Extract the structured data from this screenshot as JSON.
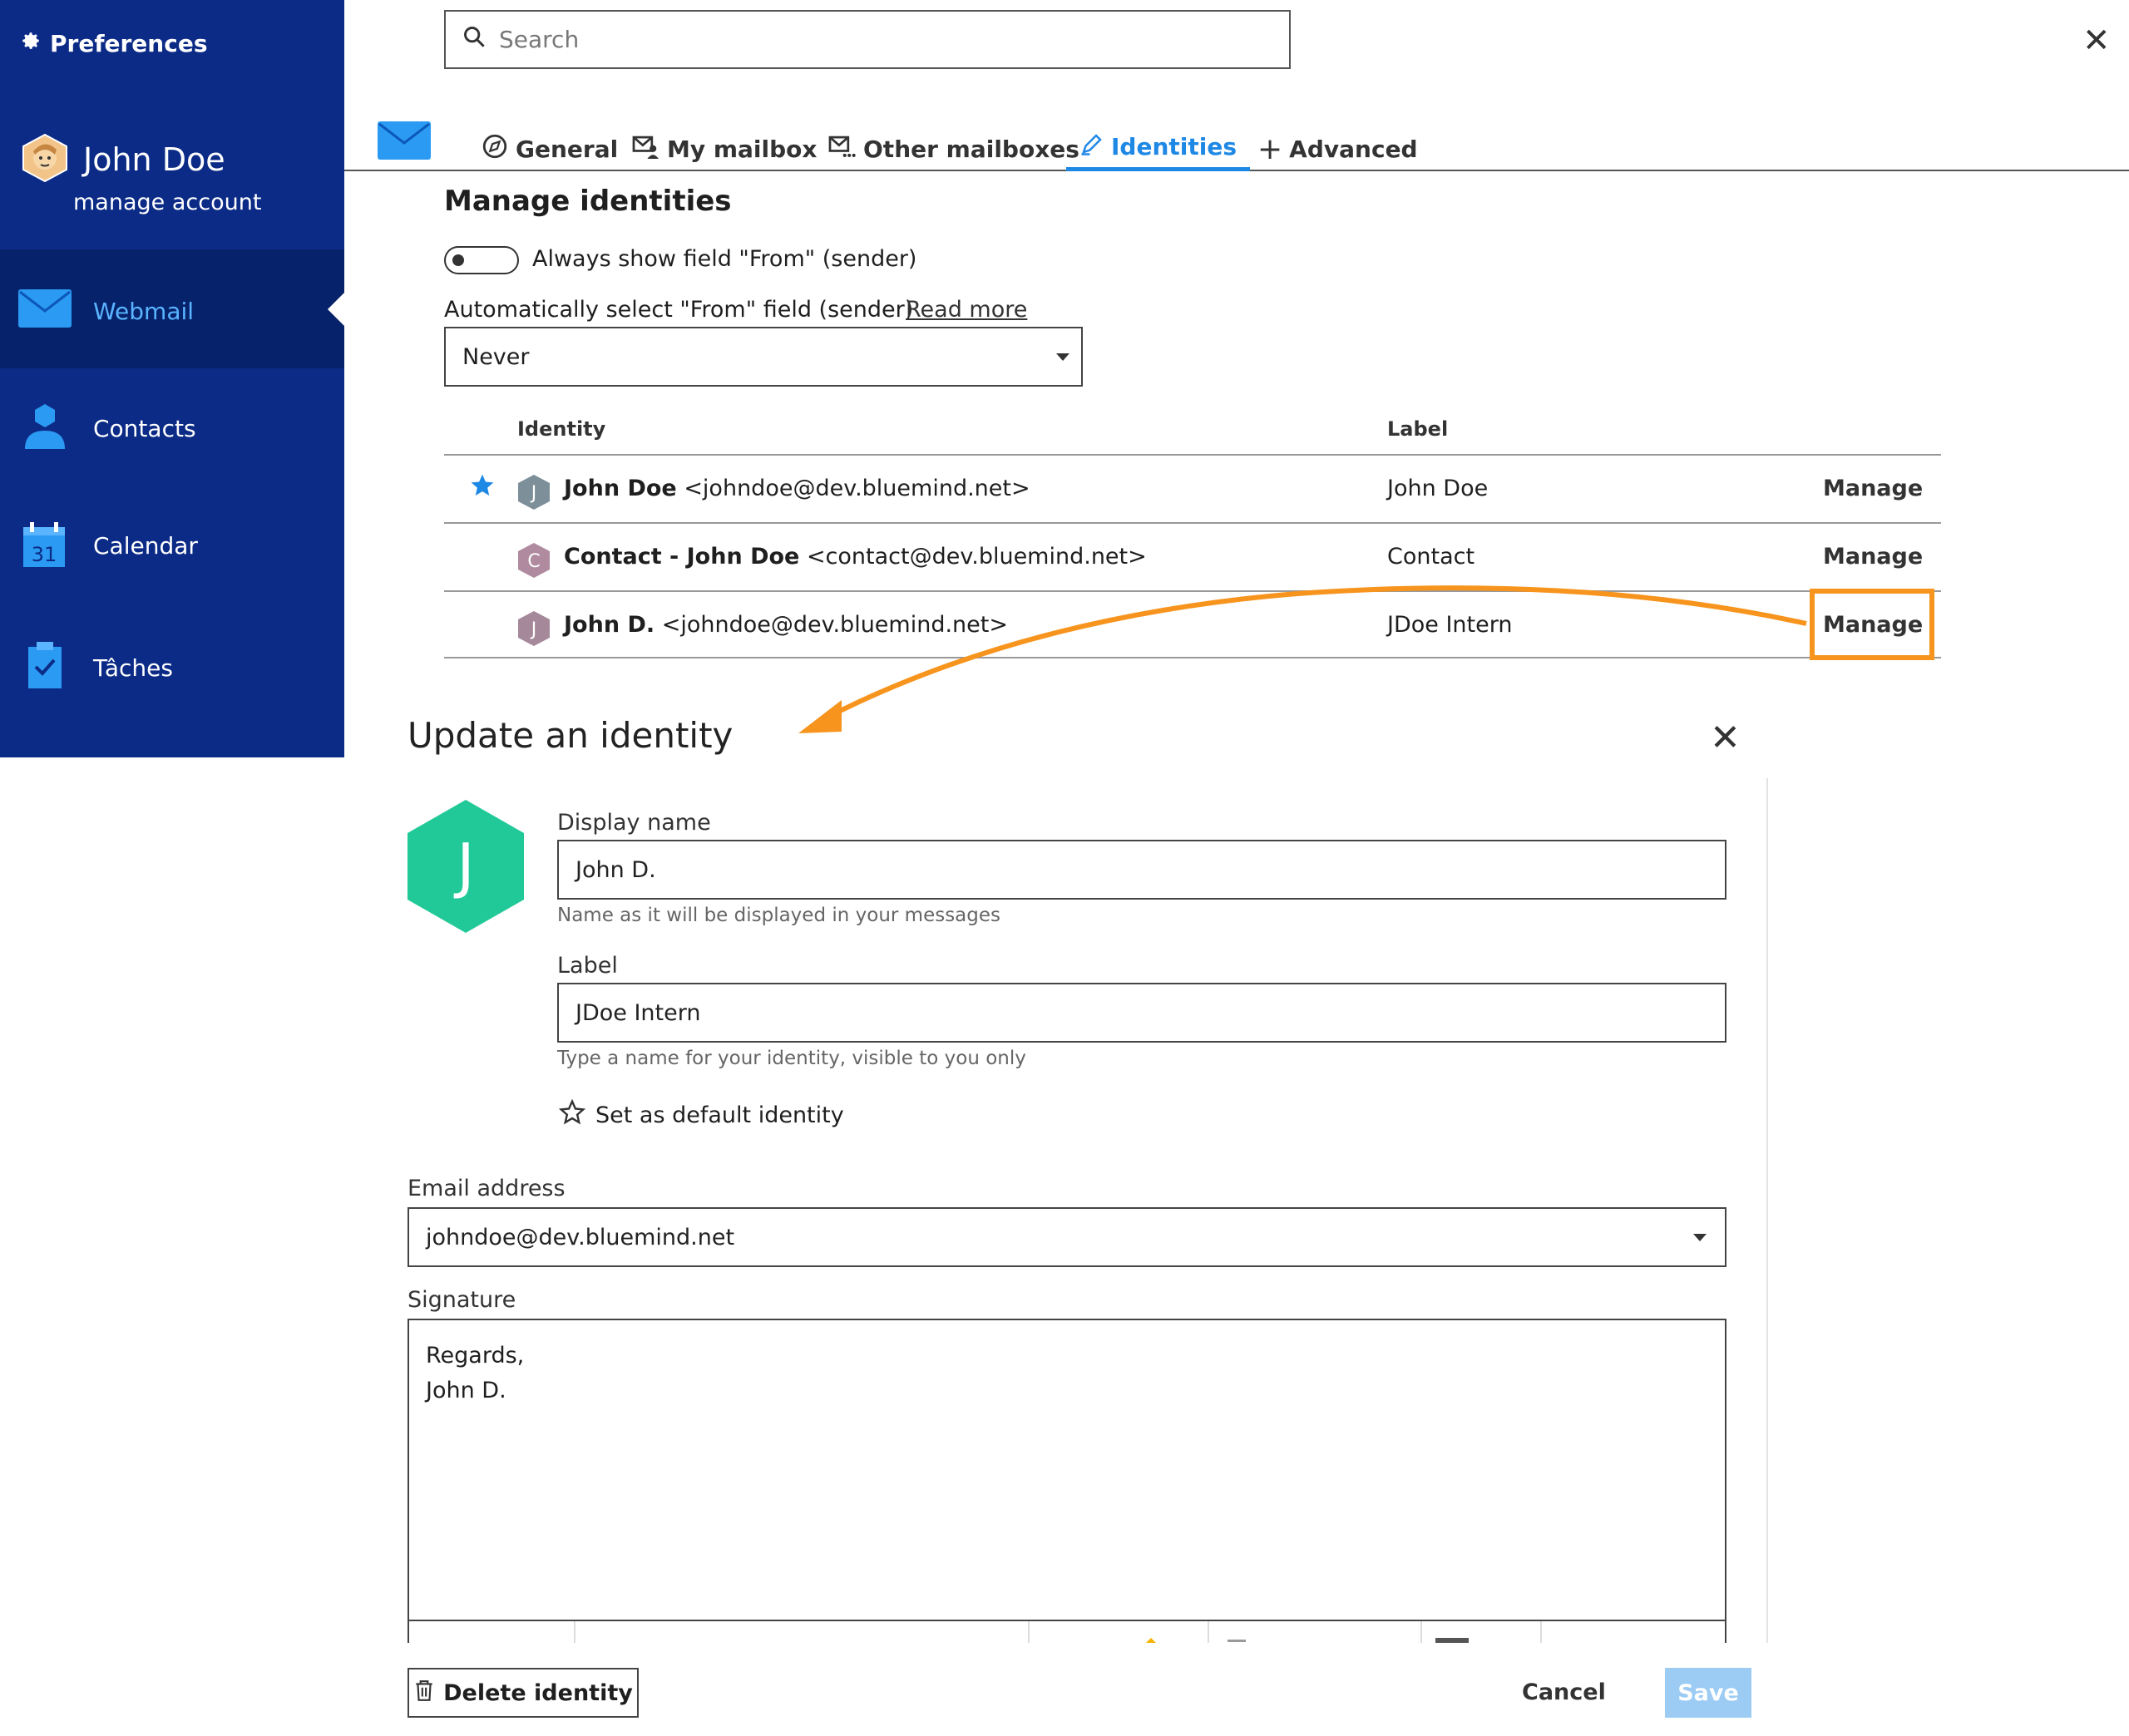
{
  "sidebar": {
    "title": "Preferences",
    "user_name": "John Doe",
    "manage_account": "manage account",
    "items": [
      {
        "label": "Webmail",
        "icon": "envelope-icon"
      },
      {
        "label": "Contacts",
        "icon": "contact-icon"
      },
      {
        "label": "Calendar",
        "icon": "calendar-icon",
        "day": "31"
      },
      {
        "label": "Tâches",
        "icon": "tasks-icon"
      }
    ]
  },
  "search": {
    "placeholder": "Search"
  },
  "tabs": [
    {
      "label": "General"
    },
    {
      "label": "My mailbox"
    },
    {
      "label": "Other mailboxes"
    },
    {
      "label": "Identities",
      "active": true
    },
    {
      "label": "Advanced"
    }
  ],
  "identities": {
    "title": "Manage identities",
    "toggle_label": "Always show field \"From\" (sender)",
    "auto_select_label": "Automatically select \"From\" field (sender)",
    "read_more": "Read more",
    "auto_select_value": "Never",
    "columns": {
      "identity": "Identity",
      "label": "Label"
    },
    "rows": [
      {
        "initial": "J",
        "name": "John Doe",
        "email": "<johndoe@dev.bluemind.net>",
        "label": "John Doe",
        "action": "Manage",
        "default": true
      },
      {
        "initial": "C",
        "name": "Contact - John Doe",
        "email": "<contact@dev.bluemind.net>",
        "label": "Contact",
        "action": "Manage",
        "default": false
      },
      {
        "initial": "J",
        "name": "John D.",
        "email": "<johndoe@dev.bluemind.net>",
        "label": "JDoe Intern",
        "action": "Manage",
        "default": false
      }
    ]
  },
  "modal": {
    "title": "Update an identity",
    "avatar_initial": "J",
    "display_name_label": "Display name",
    "display_name_value": "John D.",
    "display_name_hint": "Name as it will be displayed in your messages",
    "label_label": "Label",
    "label_value": "JDoe Intern",
    "label_hint": "Type a name for your identity, visible to you only",
    "set_default": "Set as default identity",
    "email_label": "Email address",
    "email_value": "johndoe@dev.bluemind.net",
    "signature_label": "Signature",
    "signature_line1": "Regards,",
    "signature_line2": "John D.",
    "delete_button": "Delete identity",
    "cancel_button": "Cancel",
    "save_button": "Save"
  },
  "colors": {
    "sidebar": "#0b2b86",
    "accent": "#1e88e5",
    "highlight": "#f7941d",
    "avatar": "#20c997"
  }
}
